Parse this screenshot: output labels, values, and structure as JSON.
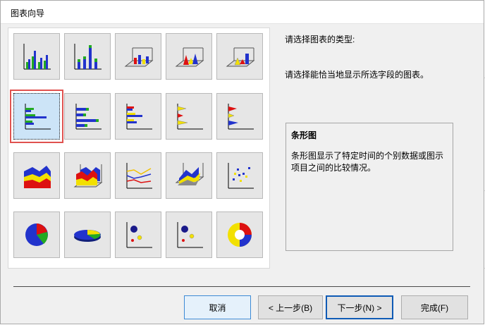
{
  "window": {
    "title": "图表向导"
  },
  "prompt_label": "请选择图表的类型:",
  "hint_label": "请选择能恰当地显示所选字段的图表。",
  "description": {
    "title": "条形图",
    "text": "条形图显示了特定时间的个别数据或图示项目之间的比较情况。"
  },
  "chart_types": [
    {
      "icon": "column-chart-icon",
      "selected": false
    },
    {
      "icon": "stacked-column-chart-icon",
      "selected": false
    },
    {
      "icon": "3d-column-chart-icon",
      "selected": false
    },
    {
      "icon": "3d-cone-chart-icon",
      "selected": false
    },
    {
      "icon": "3d-pyramid-chart-icon",
      "selected": false
    },
    {
      "icon": "bar-chart-icon",
      "selected": true
    },
    {
      "icon": "stacked-bar-chart-icon",
      "selected": false
    },
    {
      "icon": "clustered-bar-chart-icon",
      "selected": false
    },
    {
      "icon": "cone-bar-chart-icon",
      "selected": false
    },
    {
      "icon": "pyramid-bar-chart-icon",
      "selected": false
    },
    {
      "icon": "area-chart-icon",
      "selected": false
    },
    {
      "icon": "3d-area-chart-icon",
      "selected": false
    },
    {
      "icon": "line-chart-icon",
      "selected": false
    },
    {
      "icon": "3d-surface-chart-icon",
      "selected": false
    },
    {
      "icon": "scatter-chart-icon",
      "selected": false
    },
    {
      "icon": "pie-chart-icon",
      "selected": false
    },
    {
      "icon": "3d-pie-chart-icon",
      "selected": false
    },
    {
      "icon": "bubble-chart-icon",
      "selected": false
    },
    {
      "icon": "bubble-chart-alt-icon",
      "selected": false
    },
    {
      "icon": "doughnut-chart-icon",
      "selected": false
    }
  ],
  "buttons": {
    "cancel": "取消",
    "back": "< 上一步(B)",
    "next": "下一步(N) >",
    "finish": "完成(F)"
  },
  "colors": {
    "selection_outline": "#e0524f",
    "selection_fill": "#cce4f7",
    "series_blue": "#2233cc",
    "series_green": "#22aa22",
    "series_yellow": "#f2e000",
    "series_red": "#dd1111"
  }
}
